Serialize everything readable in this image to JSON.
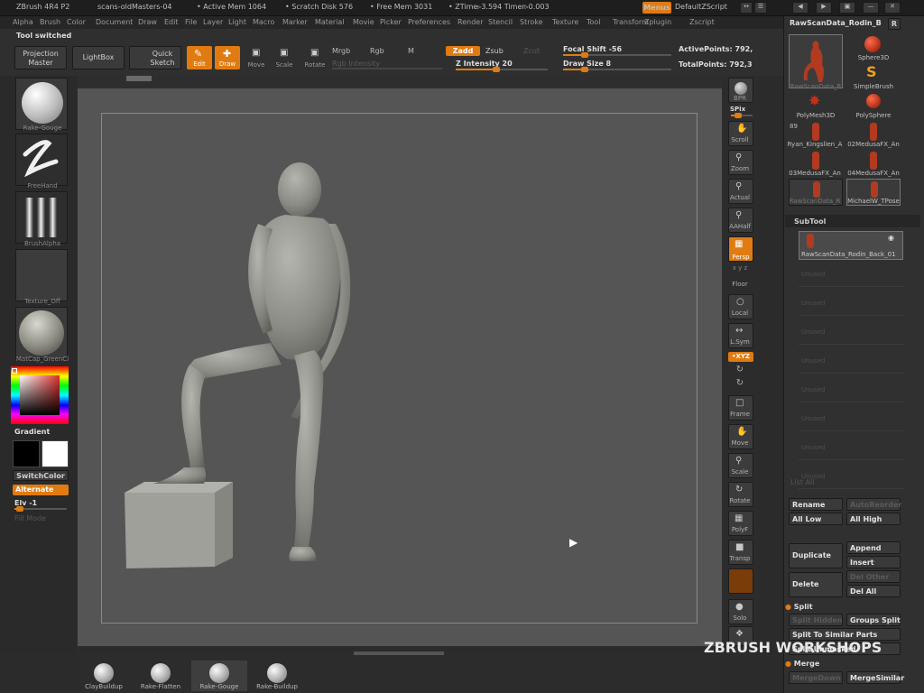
{
  "titlebar": {
    "app": "ZBrush 4R4 P2",
    "doc": "scans-oldMasters-04",
    "active_mem": "• Active Mem 1064",
    "scratch": "• Scratch Disk 576",
    "free_mem": "• Free Mem 3031",
    "ztime": "• ZTime▹3.594  Timer▹0.003",
    "menus": "Menus",
    "script": "DefaultZScript"
  },
  "menubar": [
    "Alpha",
    "Brush",
    "Color",
    "Document",
    "Draw",
    "Edit",
    "File",
    "Layer",
    "Light",
    "Macro",
    "Marker",
    "Material",
    "Movie",
    "Picker",
    "Preferences",
    "Render",
    "Stencil",
    "Stroke",
    "Texture",
    "Tool",
    "Transform",
    "Zplugin",
    "Zscript"
  ],
  "toolbar": {
    "status": "Tool switched",
    "projection_master": "Projection Master",
    "lightbox": "LightBox",
    "quick_sketch": "Quick Sketch",
    "edit": "Edit",
    "draw": "Draw",
    "move": "Move",
    "scale": "Scale",
    "rotate": "Rotate",
    "mrgb": "Mrgb",
    "rgb": "Rgb",
    "m": "M",
    "rgb_intensity": "Rgb Intensity",
    "zadd": "Zadd",
    "zsub": "Zsub",
    "zcut": "Zcut",
    "z_intensity": "Z Intensity 20",
    "focal_shift": "Focal Shift -56",
    "draw_size": "Draw Size 8",
    "active_points": "ActivePoints: 792,",
    "total_points": "TotalPoints: 792,3"
  },
  "left_shelf": {
    "brush": "Rake-Gouge",
    "stroke": "FreeHand",
    "alpha": "BrushAlpha",
    "texture": "Texture_Off",
    "material": "MatCap_GreenCl",
    "gradient": "Gradient",
    "switch_color": "SwitchColor",
    "alternate": "Alternate",
    "elv": "Elv -1",
    "fill_mode": "Fill Mode"
  },
  "right_shelf": {
    "bpr": "BPR",
    "spix": "SPix",
    "scroll": "Scroll",
    "zoom": "Zoom",
    "actual": "Actual",
    "aahalf": "AAHalf",
    "persp": "Persp",
    "floor": "Floor",
    "local": "Local",
    "lsym": "L.Sym",
    "xyz": "•XYZ",
    "frame": "Frame",
    "move": "Move",
    "scale": "Scale",
    "rotate": "Rotate",
    "polyf": "PolyF",
    "transp": "Transp",
    "solo": "Solo"
  },
  "tool_palette": {
    "current_tool": "RawScanData_Rodin_B",
    "r_btn": "R",
    "tiles": [
      "RawScanData_R",
      "Sphere3D",
      "SimpleBrush",
      "PolyMesh3D",
      "PolySphere",
      "Ryan_Kingslien_A",
      "02MedusaFX_An",
      "03MedusaFX_An",
      "04MedusaFX_An",
      "RawScanData_R",
      "MichaelW_TPose"
    ],
    "count": "89",
    "subtool_header": "SubTool",
    "subtool_active": "RawScanData_Rodin_Back_01",
    "empty_slots": [
      "Unused",
      "Unused",
      "Unused",
      "Unused",
      "Unused",
      "Unused",
      "Unused",
      "Unused"
    ],
    "list_all": "List All",
    "rename": "Rename",
    "auto_reorder": "AutoReorder",
    "all_low": "All Low",
    "all_high": "All High",
    "duplicate": "Duplicate",
    "append": "Append",
    "insert": "Insert",
    "delete": "Delete",
    "del_other": "Del Other",
    "del_all": "Del All",
    "split": "Split",
    "split_hidden": "Split Hidden",
    "groups_split": "Groups Split",
    "split_similar": "Split To Similar Parts",
    "split_unmasked": "Split Unmasked",
    "merge": "Merge",
    "merge_down": "MergeDown",
    "merge_similar": "MergeSimilar"
  },
  "bottom_brushes": [
    "ClayBuildup",
    "Rake-Flatten",
    "Rake-Gouge",
    "Rake-Buildup"
  ],
  "watermark": "ZBRUSH WORKSHOPS",
  "colors": {
    "accent": "#e07b12",
    "canvas": "#555555",
    "panel": "#303030"
  }
}
